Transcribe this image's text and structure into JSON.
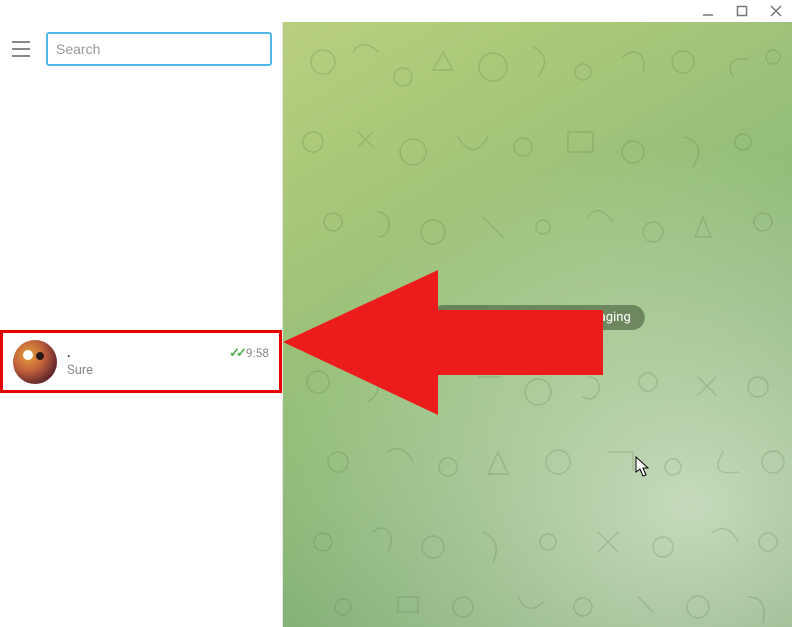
{
  "titlebar": {
    "minimize": "minimize",
    "maximize": "maximize",
    "close": "close"
  },
  "sidebar": {
    "search_placeholder": "Search",
    "search_value": ""
  },
  "chats": [
    {
      "name": ".",
      "time": "9:58",
      "preview": "Sure",
      "read_status": "read"
    }
  ],
  "main": {
    "placeholder": "Select a chat to start messaging"
  },
  "colors": {
    "accent": "#4fb6e8",
    "highlight": "#e80000",
    "check": "#4fae4e"
  }
}
